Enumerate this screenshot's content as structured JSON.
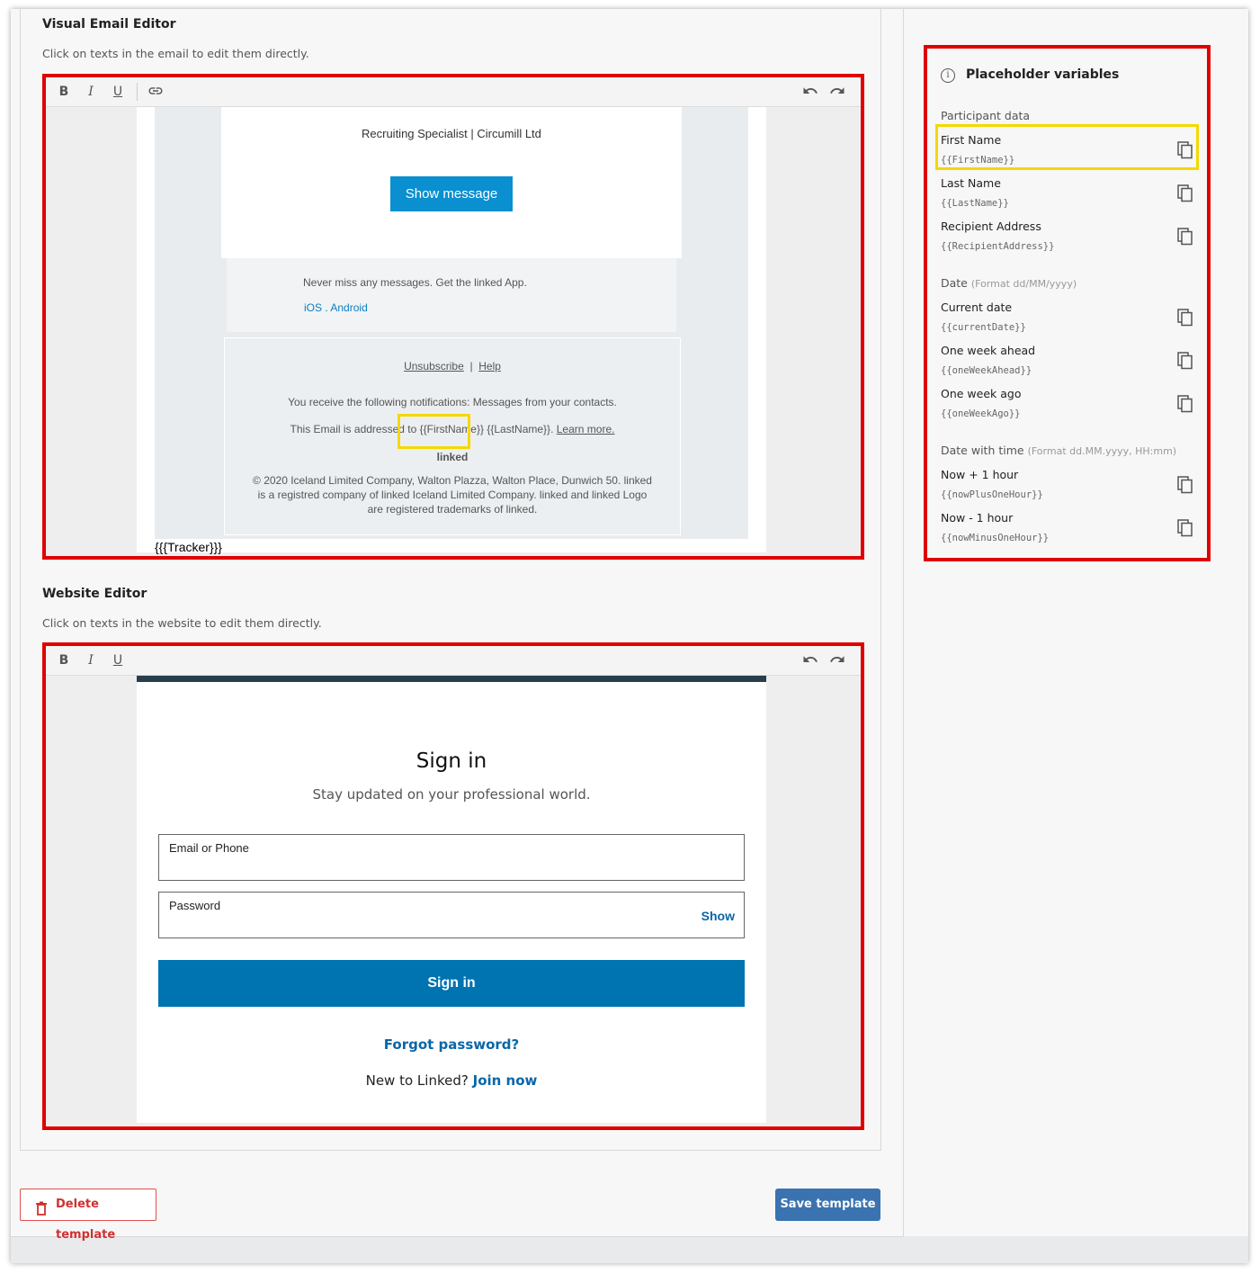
{
  "email_editor": {
    "title": "Visual Email Editor",
    "subtitle": "Click on texts in the email to edit them directly.",
    "toolbar": {
      "bold": "B",
      "italic": "I",
      "underline": "U"
    },
    "content": {
      "sender_line": "Recruiting Specialist | Circumill Ltd",
      "show_message_button": "Show message",
      "app_promo": "Never miss any messages. Get the linked App.",
      "ios": "iOS",
      "dot": ".",
      "android": "Android",
      "unsubscribe": "Unsubscribe",
      "separator": "|",
      "help": "Help",
      "notifications": "You receive the following notifications: Messages from your contacts.",
      "addressed_prefix": "This Email is addressed to",
      "first_name_var": "{{FirstName}}",
      "last_name_var": "{{LastName}}.",
      "learn_more": "Learn more.",
      "brand": "linked",
      "copyright_1": "© 2020 Iceland Limited Company, Walton Plazza, Walton Place, Dunwich 50. linked",
      "copyright_2": "is a registred company of linked Iceland Limited Company. linked and linked Logo",
      "copyright_3": "are registered trademarks of linked.",
      "tracker": "{{{Tracker}}}"
    }
  },
  "website_editor": {
    "title": "Website Editor",
    "subtitle": "Click on texts in the website to edit them directly.",
    "toolbar": {
      "bold": "B",
      "italic": "I",
      "underline": "U"
    },
    "content": {
      "heading": "Sign in",
      "tagline": "Stay updated on your professional world.",
      "email_label": "Email or Phone",
      "password_label": "Password",
      "show": "Show",
      "sign_in_button": "Sign in",
      "forgot_password": "Forgot password?",
      "new_prefix": "New to Linked?",
      "join_now": "Join now"
    }
  },
  "placeholders": {
    "title": "Placeholder variables",
    "groups": [
      {
        "label": "Participant data",
        "format": ""
      },
      {
        "label": "Date",
        "format": "(Format dd/MM/yyyy)"
      },
      {
        "label": "Date with time",
        "format": "(Format dd.MM.yyyy, HH:mm)"
      }
    ],
    "items": [
      {
        "name": "First Name",
        "code": "{{FirstName}}"
      },
      {
        "name": "Last Name",
        "code": "{{LastName}}"
      },
      {
        "name": "Recipient Address",
        "code": "{{RecipientAddress}}"
      },
      {
        "name": "Current date",
        "code": "{{currentDate}}"
      },
      {
        "name": "One week ahead",
        "code": "{{oneWeekAhead}}"
      },
      {
        "name": "One week ago",
        "code": "{{oneWeekAgo}}"
      },
      {
        "name": "Now + 1 hour",
        "code": "{{nowPlusOneHour}}"
      },
      {
        "name": "Now - 1 hour",
        "code": "{{nowMinusOneHour}}"
      }
    ]
  },
  "actions": {
    "delete": "Delete template",
    "save": "Save template"
  },
  "colors": {
    "highlight_red": "#e00000",
    "highlight_yellow": "#f5d800",
    "primary_blue": "#0073b1",
    "save_blue": "#3a73b0",
    "danger": "#d23030"
  }
}
